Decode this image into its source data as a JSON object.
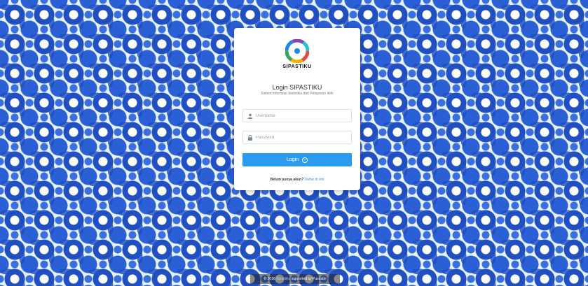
{
  "colors": {
    "background_pattern": "#1f4fc2",
    "background_base": "#e6f3f7",
    "card": "#ffffff",
    "accent": "#2b9bf0"
  },
  "login_card": {
    "logo_icon": "multicolor-ring-logo",
    "brand": "SIPASTIKU",
    "title": "Login SIPASTIKU",
    "subtitle": "Sistem Informasi Statistika dan Pelaporan Ikifo",
    "username": {
      "value": "",
      "placeholder": "Username",
      "icon": "user-icon"
    },
    "password": {
      "value": "",
      "placeholder": "Password",
      "icon": "lock-icon"
    },
    "login_button": {
      "label": "Login",
      "icon": "arrow-circle-right-icon"
    },
    "footer_prefix": "Belum punya akun?",
    "footer_link": "Daftar di sini"
  },
  "copyright": {
    "prefix": "© 2016 ",
    "link": "Sipastiku",
    "suffix": " supported by Pusdatin"
  }
}
